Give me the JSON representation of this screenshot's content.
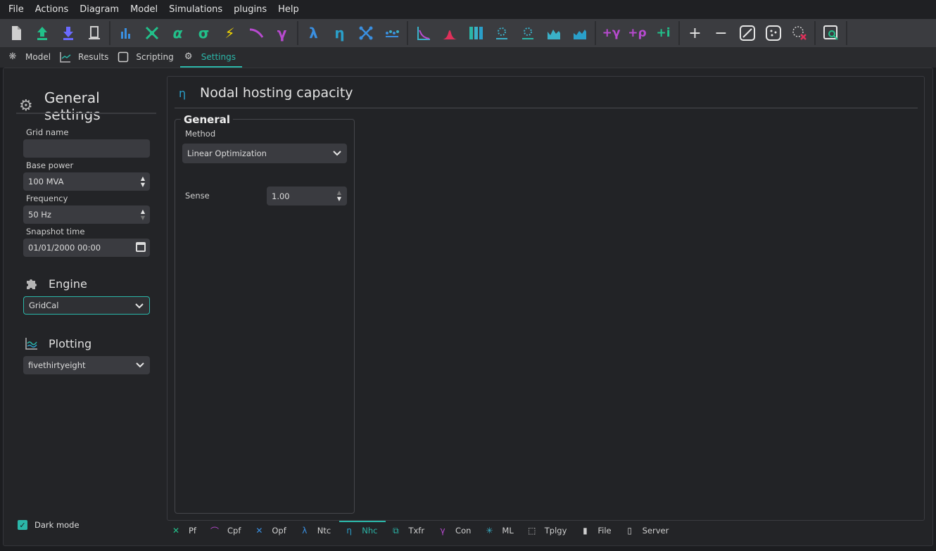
{
  "menu": [
    "File",
    "Actions",
    "Diagram",
    "Model",
    "Simulations",
    "plugins",
    "Help"
  ],
  "top_tabs": [
    {
      "label": "Model",
      "icon": "model-icon"
    },
    {
      "label": "Results",
      "icon": "chart-icon"
    },
    {
      "label": "Scripting",
      "icon": "console-icon"
    },
    {
      "label": "Settings",
      "icon": "gear-icon",
      "active": true
    }
  ],
  "general": {
    "title": "General settings",
    "grid_name_label": "Grid name",
    "grid_name_value": "",
    "base_power_label": "Base power",
    "base_power_value": "100 MVA",
    "frequency_label": "Frequency",
    "frequency_value": "50 Hz",
    "snapshot_label": "Snapshot time",
    "snapshot_value": "01/01/2000 00:00"
  },
  "engine": {
    "title": "Engine",
    "value": "GridCal"
  },
  "plotting": {
    "title": "Plotting",
    "value": "fivethirtyeight"
  },
  "dark_mode": {
    "label": "Dark mode",
    "checked": true
  },
  "panel": {
    "symbol": "η",
    "title": "Nodal hosting capacity",
    "group_title": "General",
    "method_label": "Method",
    "method_value": "Linear Optimization",
    "sense_label": "Sense",
    "sense_value": "1.00"
  },
  "bottom_tabs": [
    {
      "label": "Pf",
      "symbol": "✕",
      "color": "#22c08a"
    },
    {
      "label": "Cpf",
      "symbol": "⌒",
      "color": "#b84ad0"
    },
    {
      "label": "Opf",
      "symbol": "✕",
      "color": "#3a8fe0"
    },
    {
      "label": "Ntc",
      "symbol": "λ",
      "color": "#3a8fe0"
    },
    {
      "label": "Nhc",
      "symbol": "η",
      "color": "#2a9fc9",
      "active": true
    },
    {
      "label": "Txfr",
      "symbol": "⧉",
      "color": "#2bb6a8"
    },
    {
      "label": "Con",
      "symbol": "γ",
      "color": "#b84ad0"
    },
    {
      "label": "ML",
      "symbol": "✳",
      "color": "#3ab0c8"
    },
    {
      "label": "Tplgy",
      "symbol": "⬚",
      "color": "#cfcfcf"
    },
    {
      "label": "File",
      "symbol": "▮",
      "color": "#cfcfcf"
    },
    {
      "label": "Server",
      "symbol": "▯",
      "color": "#cfcfcf"
    }
  ],
  "colors": {
    "accent": "#2bb6a8",
    "background": "#1c1d20",
    "toolbar": "#3b3c40"
  }
}
